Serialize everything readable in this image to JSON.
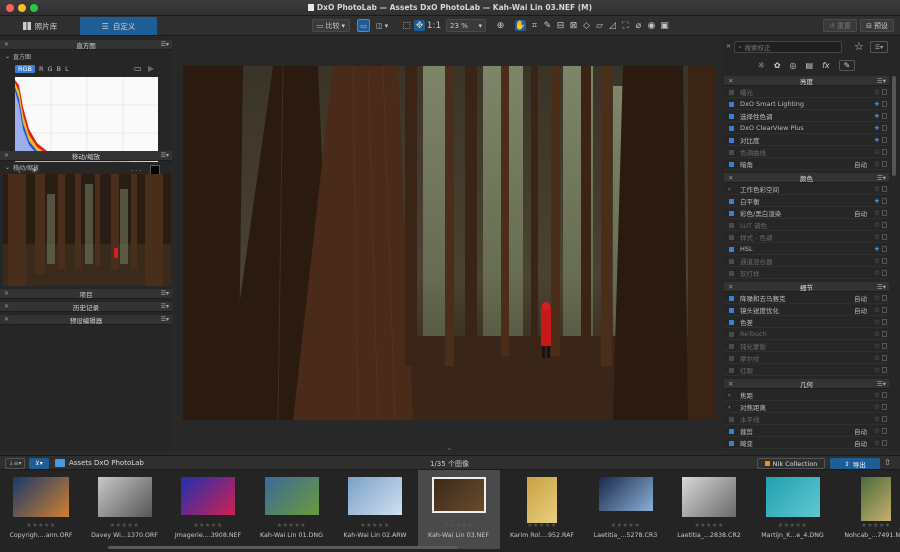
{
  "window": {
    "title": "DxO PhotoLab — Assets DxO PhotoLab — Kah-Wai Lin 03.NEF (M)"
  },
  "toolbar": {
    "tab_library": "照片库",
    "tab_customize": "自定义",
    "compare_label": "比较",
    "ratio_label": "1:1",
    "zoom_value": "23 %",
    "reset_label": "重置",
    "preset_label": "预设"
  },
  "left": {
    "histogram_title": "直方图",
    "histogram_sub": "直方图",
    "channels": [
      "RGB",
      "R",
      "G",
      "B",
      "L"
    ],
    "nav_title": "移动/缩放",
    "nav_sub": "移动/缩放",
    "projects_title": "项目",
    "history_title": "历史记录",
    "preset_editor_title": "预设编辑器"
  },
  "right": {
    "search_placeholder": "搜索校正",
    "fx_label": "fx",
    "sections": [
      {
        "title": "亮度",
        "rows": [
          {
            "label": "曝光",
            "state": "off",
            "auto": "",
            "fav": false
          },
          {
            "label": "DxO Smart Lighting",
            "state": "on",
            "auto": "",
            "fav": true
          },
          {
            "label": "选择性色调",
            "state": "on",
            "auto": "",
            "fav": true
          },
          {
            "label": "DxO ClearView Plus",
            "state": "on",
            "auto": "",
            "fav": true
          },
          {
            "label": "对比度",
            "state": "on",
            "auto": "",
            "fav": true
          },
          {
            "label": "色调曲线",
            "state": "off",
            "auto": "",
            "fav": false
          },
          {
            "label": "暗角",
            "state": "on",
            "auto": "自动",
            "fav": false
          }
        ]
      },
      {
        "title": "颜色",
        "rows": [
          {
            "label": "工作色彩空间",
            "state": "sub",
            "auto": "",
            "fav": false
          },
          {
            "label": "白平衡",
            "state": "on",
            "auto": "",
            "fav": true
          },
          {
            "label": "彩色/黑白渲染",
            "state": "on",
            "auto": "自动",
            "fav": false
          },
          {
            "label": "LUT 调色",
            "state": "off",
            "auto": "",
            "fav": false
          },
          {
            "label": "样式 - 色调",
            "state": "off",
            "auto": "",
            "fav": false
          },
          {
            "label": "HSL",
            "state": "on",
            "auto": "",
            "fav": true
          },
          {
            "label": "通道混合器",
            "state": "off",
            "auto": "",
            "fav": false
          },
          {
            "label": "软打样",
            "state": "off",
            "auto": "",
            "fav": false
          }
        ]
      },
      {
        "title": "细节",
        "rows": [
          {
            "label": "降噪和去马赛克",
            "state": "on",
            "auto": "自动",
            "fav": false
          },
          {
            "label": "镜头锐度优化",
            "state": "on",
            "auto": "自动",
            "fav": false
          },
          {
            "label": "色差",
            "state": "on",
            "auto": "",
            "fav": false
          },
          {
            "label": "ReTouch",
            "state": "off",
            "auto": "",
            "fav": false
          },
          {
            "label": "钝化蒙版",
            "state": "off",
            "auto": "",
            "fav": false
          },
          {
            "label": "摩尔纹",
            "state": "off",
            "auto": "",
            "fav": false
          },
          {
            "label": "红眼",
            "state": "off",
            "auto": "",
            "fav": false
          }
        ]
      },
      {
        "title": "几何",
        "rows": [
          {
            "label": "焦距",
            "state": "sub",
            "auto": "",
            "fav": false
          },
          {
            "label": "对焦距离",
            "state": "sub",
            "auto": "",
            "fav": false
          },
          {
            "label": "水平线",
            "state": "off",
            "auto": "",
            "fav": false
          },
          {
            "label": "裁剪",
            "state": "on",
            "auto": "自动",
            "fav": false
          },
          {
            "label": "畸变",
            "state": "on",
            "auto": "自动",
            "fav": false
          }
        ]
      }
    ]
  },
  "filmstrip": {
    "folder": "Assets DxO PhotoLab",
    "count": "1/35 个图像",
    "nik_label": "Nik Collection",
    "export_label": "导出",
    "thumbs": [
      {
        "name": "Copyrigh....ann.ORF",
        "c1": "#1a3a6a",
        "c2": "#d08030",
        "w": 56,
        "h": 40
      },
      {
        "name": "Davey Wi...1370.ORF",
        "c1": "#c8c8c8",
        "c2": "#555555",
        "w": 54,
        "h": 40
      },
      {
        "name": "Jmagerie....3908.NEF",
        "c1": "#2030b0",
        "c2": "#d02050",
        "w": 54,
        "h": 38
      },
      {
        "name": "Kah-Wai Lin 01.DNG",
        "c1": "#3a6a9a",
        "c2": "#6a9a3a",
        "w": 54,
        "h": 38
      },
      {
        "name": "Kah-Wai Lin 02.ARW",
        "c1": "#7aa0c8",
        "c2": "#d0e0f0",
        "w": 54,
        "h": 38
      },
      {
        "name": "Kah-Wai Lin 03.NEF",
        "c1": "#3a2a1a",
        "c2": "#6a4a2a",
        "w": 54,
        "h": 36
      },
      {
        "name": "Karim Rol....952.RAF",
        "c1": "#c8a040",
        "c2": "#e8d080",
        "w": 30,
        "h": 46
      },
      {
        "name": "Laetitia_...5278.CR3",
        "c1": "#1a2a4a",
        "c2": "#8ab0d8",
        "w": 54,
        "h": 34
      },
      {
        "name": "Laetitia_...2838.CR2",
        "c1": "#d8d8d8",
        "c2": "#6a6a6a",
        "w": 54,
        "h": 40
      },
      {
        "name": "Martijn_K...e_4.DNG",
        "c1": "#20a0b0",
        "c2": "#60c8d0",
        "w": 54,
        "h": 40
      },
      {
        "name": "Nohcab_...7491.NEF",
        "c1": "#4a6a3a",
        "c2": "#c8b070",
        "w": 30,
        "h": 44
      }
    ]
  }
}
